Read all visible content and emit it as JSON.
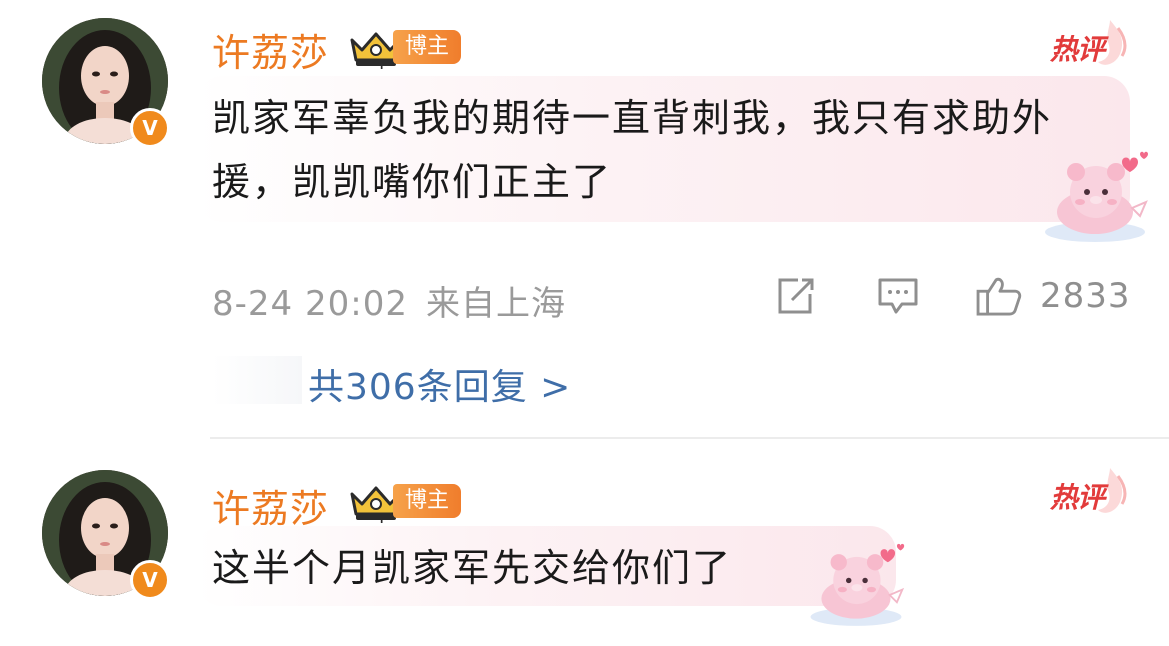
{
  "comments": [
    {
      "username": "许荔莎",
      "role_badge": "博主",
      "hot_tag": "热评",
      "content": "凯家军辜负我的期待一直背刺我，我只有求助外援，凯凯嘴你们正主了",
      "time": "8-24 20:02",
      "location": "来自上海",
      "like_count": "2833",
      "replies_text": "共306条回复 >"
    },
    {
      "username": "许荔莎",
      "role_badge": "博主",
      "hot_tag": "热评",
      "content": "这半个月凯家军先交给你们了"
    }
  ],
  "colors": {
    "username": "#ec7a22",
    "verified_badge": "#f08a1c",
    "hot_tag": "#e23b3b",
    "link": "#3f6ea8",
    "meta": "#9a9a9a"
  },
  "icons": {
    "verified": "v-badge-icon",
    "crown": "crown-icon",
    "hot": "hot-comment-icon",
    "share": "share-icon",
    "reply": "comment-icon",
    "like": "thumbs-up-icon",
    "sticker": "pink-bear-sticker"
  },
  "verified_label": "V"
}
